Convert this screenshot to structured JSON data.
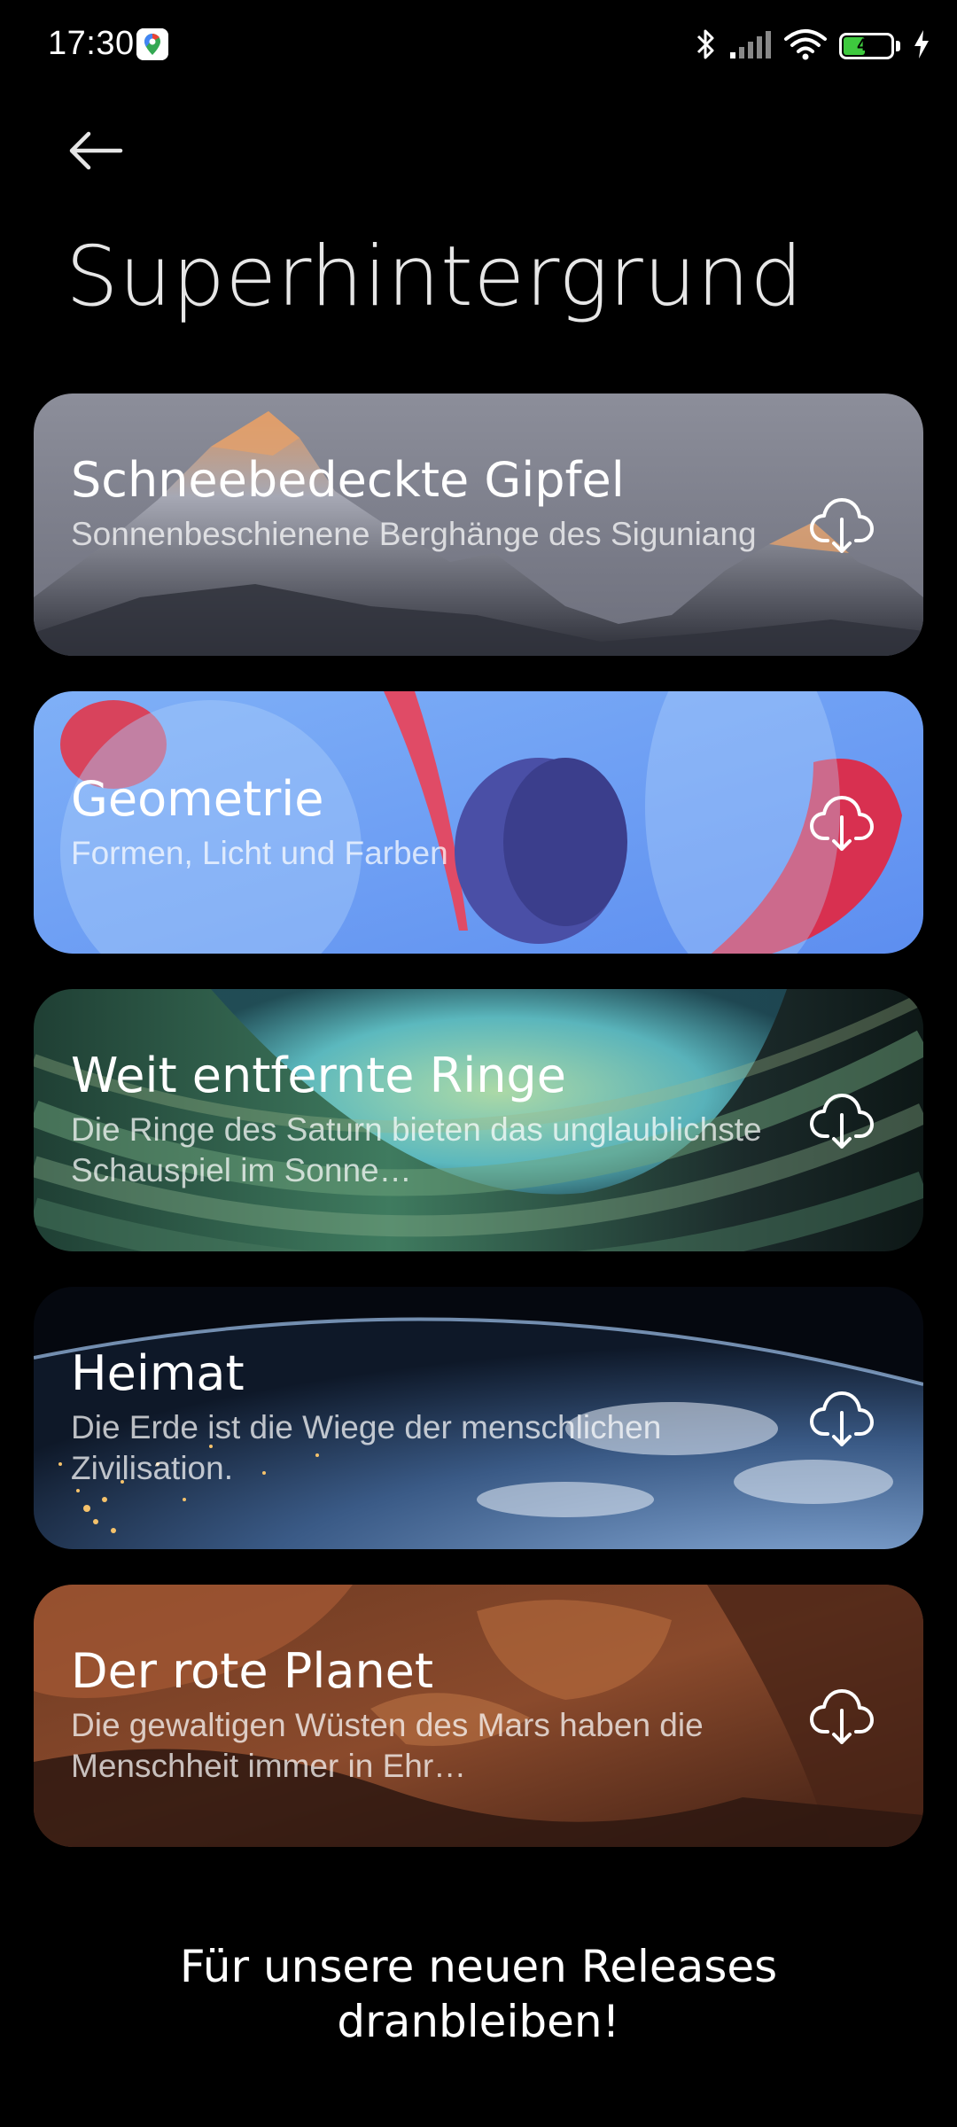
{
  "status_bar": {
    "time": "17:30",
    "battery": "47",
    "battery_level": 0.47,
    "icons": [
      "maps-icon",
      "bluetooth-icon",
      "signal-icon",
      "wifi-icon",
      "battery-icon",
      "charging-icon"
    ]
  },
  "header": {
    "back_icon": "arrow-left-icon",
    "title": "Superhintergrund"
  },
  "cards": [
    {
      "title": "Schneebedeckte Gipfel",
      "description": "Sonnenbeschienene Berghänge des Siguniang",
      "action_icon": "cloud-download-icon"
    },
    {
      "title": "Geometrie",
      "description": "Formen, Licht und Farben",
      "action_icon": "cloud-download-icon"
    },
    {
      "title": "Weit entfernte Ringe",
      "description": "Die Ringe des Saturn bieten das unglaublichste Schauspiel im Sonne…",
      "action_icon": "cloud-download-icon"
    },
    {
      "title": "Heimat",
      "description": "Die Erde ist die Wiege der menschlichen Zivilisation.",
      "action_icon": "cloud-download-icon"
    },
    {
      "title": "Der rote Planet",
      "description": "Die gewaltigen Wüsten des Mars haben die Menschheit immer in Ehr…",
      "action_icon": "cloud-download-icon"
    }
  ],
  "footer": {
    "line1": "Für unsere neuen Releases",
    "line2": "dranbleiben!"
  },
  "colors": {
    "background": "#000000",
    "battery_fill": "#3ec93e",
    "geometry_blue": "#6fa0f2",
    "mars_rust": "#8a4a2c"
  }
}
